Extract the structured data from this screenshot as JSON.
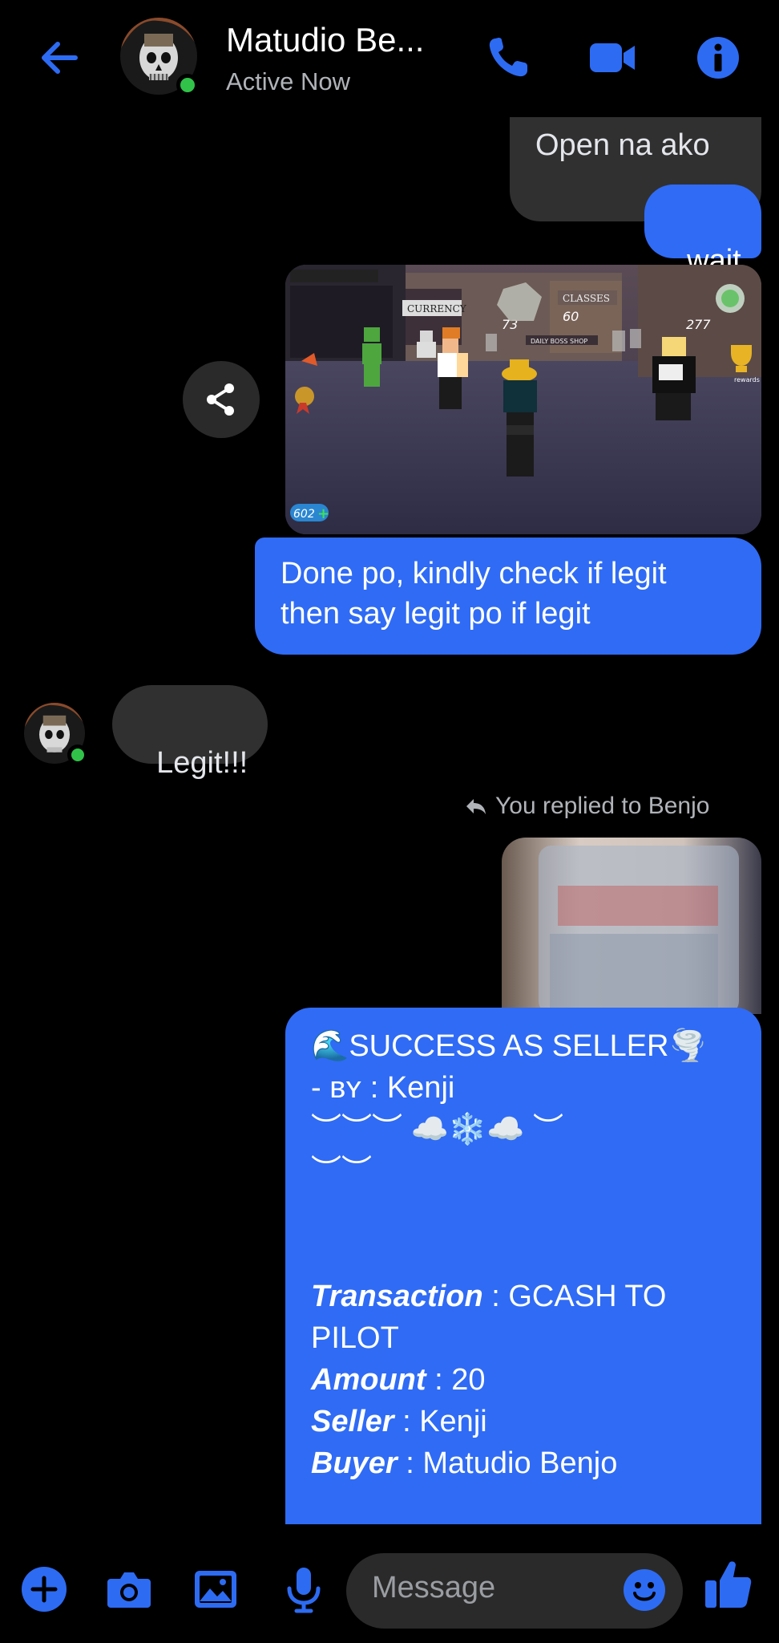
{
  "header": {
    "name": "Matudio Be...",
    "status": "Active Now"
  },
  "messages": {
    "m1": "Open na ako",
    "m2": "wait",
    "m3_line1": "Done po, kindly check if legit",
    "m3_line2": "then say legit po if legit",
    "m4": "Legit!!!",
    "reply_label": "You replied to Benjo"
  },
  "game_screenshot": {
    "currency_label": "CURRENCY",
    "classes_label": "CLASSES",
    "coins": "602",
    "counter_a": "73",
    "counter_b": "60",
    "counter_c": "277",
    "shop_label": "DAILY BOSS SHOP",
    "rewards_label": "rewards"
  },
  "success_card": {
    "line1": "SUCCESS AS SELLER",
    "by_prefix": "- ʙʏ : ",
    "by_name": "Kenji",
    "deco1": "︶︶︶ ☁️❄️☁️ ︶",
    "deco2": "︶︶",
    "transaction_label": "Transaction",
    "transaction_value": " : GCASH TO",
    "transaction_value2": "PILOT",
    "amount_label": "Amount",
    "amount_value": " : 20",
    "seller_label": "Seller",
    "seller_value": " : Kenji",
    "buyer_label": "Buyer",
    "buyer_value": " : Matudio Benjo"
  },
  "composer": {
    "placeholder": "Message"
  },
  "colors": {
    "accent": "#2f6bf5",
    "icon_blue": "#2d6bf2",
    "online": "#31c24a",
    "grey_bubble": "#303030"
  }
}
